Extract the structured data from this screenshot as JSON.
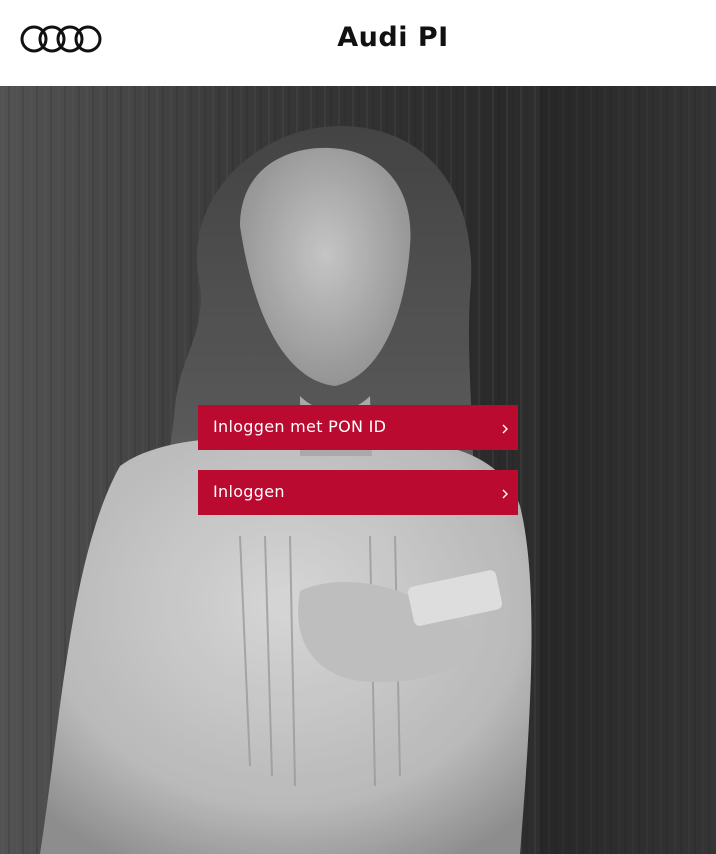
{
  "header": {
    "logo_icon": "audi-rings-icon",
    "title": "Audi PI"
  },
  "hero": {
    "image": "black-and-white photo of woman holding a smartphone against a wooden wall"
  },
  "buttons": {
    "pon_login_label": "Inloggen met PON ID",
    "login_label": "Inloggen",
    "chevron_icon": "chevron-right-icon",
    "color": "#bb0a30"
  }
}
